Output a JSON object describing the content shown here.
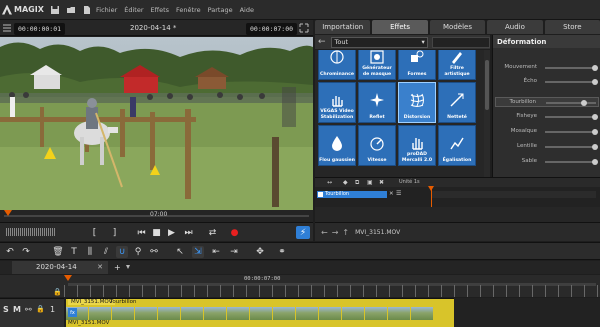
{
  "menu": {
    "logo": "MAGIX",
    "items": [
      "Fichier",
      "Éditer",
      "Effets",
      "Fenêtre",
      "Partage",
      "Aide"
    ]
  },
  "preview": {
    "timecode_left": "00:00:00:01",
    "title": "2020-04-14 *",
    "timecode_right": "00:00:07:00",
    "scrub_label": "07:00"
  },
  "pool": {
    "tabs": [
      "Importation",
      "Effets",
      "Modèles",
      "Audio",
      "Store"
    ],
    "active_tab": "Effets",
    "category": "Tout",
    "tiles": [
      {
        "label": "Chrominance",
        "icon": "chrominance-icon"
      },
      {
        "label": "Générateur de masque",
        "icon": "mask-generator-icon"
      },
      {
        "label": "Formes",
        "icon": "shapes-icon"
      },
      {
        "label": "Filtre artistique",
        "icon": "art-filter-icon"
      },
      {
        "label": "VEGAS Video Stabilization",
        "icon": "stabilization-hand-icon"
      },
      {
        "label": "Reflet",
        "icon": "reflection-icon"
      },
      {
        "label": "Distorsion",
        "icon": "distortion-grid-icon",
        "selected": true
      },
      {
        "label": "Netteté",
        "icon": "sharpness-icon"
      },
      {
        "label": "Flou gaussien",
        "icon": "blur-drop-icon"
      },
      {
        "label": "Vitesse",
        "icon": "speed-icon"
      },
      {
        "label": "proDAD Mercalli 2.0",
        "icon": "mercalli-hand-icon"
      },
      {
        "label": "Égalisation",
        "icon": "equalization-icon"
      }
    ],
    "deformation": {
      "title": "Déformation",
      "items": [
        {
          "label": "Mouvement"
        },
        {
          "label": "Écho"
        },
        {
          "label": "Tourbillon",
          "active": true
        },
        {
          "label": "Fisheye"
        },
        {
          "label": "Mosaïque"
        },
        {
          "label": "Lentille"
        },
        {
          "label": "Sable"
        }
      ]
    },
    "mini_timeline": {
      "unit_label": "Unité",
      "unit_value": "1s",
      "row_label": "Tourbillon"
    },
    "bottom_filename": "MVI_3151.MOV"
  },
  "timeline": {
    "tab_label": "2020-04-14",
    "ruler_timecode": "00:00:07:00",
    "track": {
      "solo": "S",
      "mute": "M",
      "number": "1"
    },
    "clip": {
      "name": "MVI_3151.MOV",
      "effect": "Tourbillon",
      "name_bottom": "MVI_3151.MOV"
    }
  },
  "colors": {
    "accent": "#2f7fd6",
    "playhead": "#e65c00",
    "clip": "#d8c42a"
  }
}
